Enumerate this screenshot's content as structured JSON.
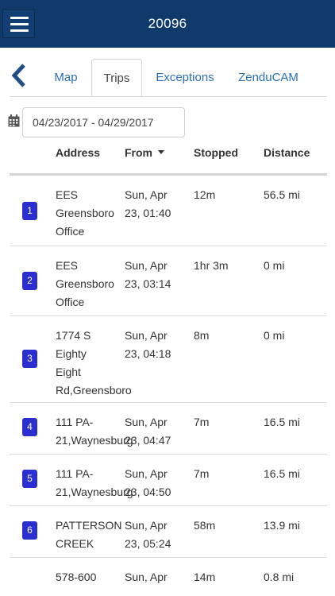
{
  "header": {
    "title": "20096"
  },
  "tabs": [
    {
      "label": "Map"
    },
    {
      "label": "Trips"
    },
    {
      "label": "Exceptions"
    },
    {
      "label": "ZenduCAM"
    }
  ],
  "date_range": {
    "value": "04/23/2017 - 04/29/2017"
  },
  "columns": {
    "address": "Address",
    "from": "From",
    "stopped": "Stopped",
    "distance": "Distance"
  },
  "trips": [
    {
      "num": "1",
      "address": " EES\nGreensboro\nOffice",
      "from": "Sun, Apr\n23, 01:40",
      "stopped": "12m",
      "distance": "56.5 mi"
    },
    {
      "num": "2",
      "address": " EES\nGreensboro\nOffice",
      "from": "Sun, Apr\n23, 03:14",
      "stopped": "1hr 3m",
      "distance": "0 mi"
    },
    {
      "num": "3",
      "address": " 1774 S\nEighty\nEight\nRd,Greensboro",
      "from": "Sun, Apr\n23, 04:18",
      "stopped": "8m",
      "distance": "0 mi"
    },
    {
      "num": "4",
      "address": " 111 PA-\n21,Waynesburg",
      "from": "Sun, Apr\n23, 04:47",
      "stopped": "7m",
      "distance": "16.5 mi"
    },
    {
      "num": "5",
      "address": " 111 PA-\n21,Waynesburg",
      "from": "Sun, Apr\n23, 04:50",
      "stopped": "7m",
      "distance": "16.5 mi"
    },
    {
      "num": "6",
      "address": " PATTERSON\nCREEK",
      "from": "Sun, Apr\n23, 05:24",
      "stopped": "58m",
      "distance": "13.9 mi"
    },
    {
      "num": "",
      "address": " 578-600",
      "from": "Sun, Apr",
      "stopped": "14m",
      "distance": "0.8 mi"
    }
  ],
  "colors": {
    "header_bg": "#0f3a6b",
    "tab_link": "#2a6fb5",
    "badge": "#2b2fcf"
  },
  "icons": {
    "menu": "hamburger-icon",
    "back": "chevron-left-icon",
    "calendar": "calendar-icon",
    "sort": "caret-down-icon"
  }
}
